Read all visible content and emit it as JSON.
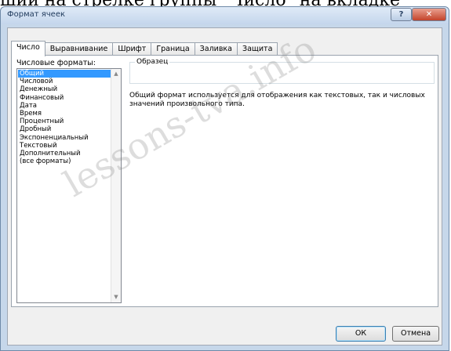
{
  "document": {
    "background_text": "ший на стрелке группы \"Число\" на вкладке"
  },
  "dialog": {
    "title": "Формат ячеек",
    "help_label": "?",
    "close_label": "✕",
    "tabs": [
      {
        "label": "Число",
        "active": true
      },
      {
        "label": "Выравнивание",
        "active": false
      },
      {
        "label": "Шрифт",
        "active": false
      },
      {
        "label": "Граница",
        "active": false
      },
      {
        "label": "Заливка",
        "active": false
      },
      {
        "label": "Защита",
        "active": false
      }
    ],
    "formats_label": "Числовые форматы:",
    "formats": [
      {
        "label": "Общий",
        "selected": true
      },
      {
        "label": "Числовой",
        "selected": false
      },
      {
        "label": "Денежный",
        "selected": false
      },
      {
        "label": "Финансовый",
        "selected": false
      },
      {
        "label": "Дата",
        "selected": false
      },
      {
        "label": "Время",
        "selected": false
      },
      {
        "label": "Процентный",
        "selected": false
      },
      {
        "label": "Дробный",
        "selected": false
      },
      {
        "label": "Экспоненциальный",
        "selected": false
      },
      {
        "label": "Текстовый",
        "selected": false
      },
      {
        "label": "Дополнительный",
        "selected": false
      },
      {
        "label": "(все форматы)",
        "selected": false
      }
    ],
    "sample_label": "Образец",
    "description": "Общий формат используется для отображения как текстовых, так и числовых значений произвольного типа.",
    "ok_label": "ОК",
    "cancel_label": "Отмена"
  },
  "watermark": "lessons-tva.info",
  "colors": {
    "selection": "#3399ff",
    "title_bar": "#c4d6ec",
    "close_button": "#c3432a"
  },
  "icons": [
    "help-icon",
    "close-icon",
    "scroll-up-icon",
    "scroll-down-icon"
  ]
}
